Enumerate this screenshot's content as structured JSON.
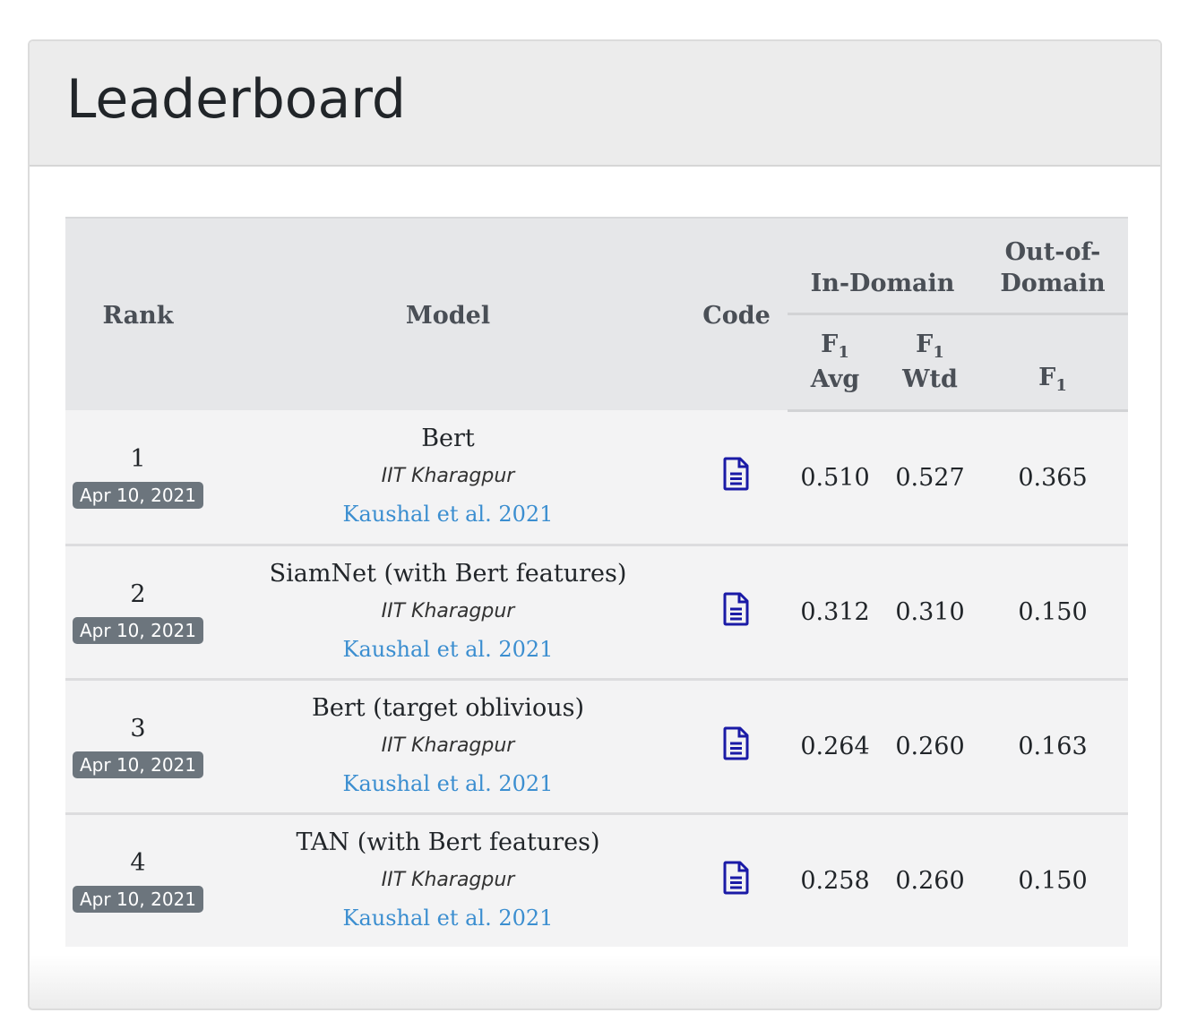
{
  "card": {
    "title": "Leaderboard"
  },
  "table": {
    "headers": {
      "rank": "Rank",
      "model": "Model",
      "code": "Code",
      "in_domain": "In-Domain",
      "out_of_domain_1": "Out-of-",
      "out_of_domain_2": "Domain",
      "f": "F",
      "f_sub": "1",
      "avg": "Avg",
      "wtd": "Wtd"
    },
    "rows": [
      {
        "rank": "1",
        "date": "Apr 10, 2021",
        "model": "Bert",
        "org": "IIT Kharagpur",
        "link": "Kaushal et al. 2021",
        "f1_avg": "0.510",
        "f1_wtd": "0.527",
        "ood_f1": "0.365"
      },
      {
        "rank": "2",
        "date": "Apr 10, 2021",
        "model": "SiamNet (with Bert features)",
        "org": "IIT Kharagpur",
        "link": "Kaushal et al. 2021",
        "f1_avg": "0.312",
        "f1_wtd": "0.310",
        "ood_f1": "0.150"
      },
      {
        "rank": "3",
        "date": "Apr 10, 2021",
        "model": "Bert (target oblivious)",
        "org": "IIT Kharagpur",
        "link": "Kaushal et al. 2021",
        "f1_avg": "0.264",
        "f1_wtd": "0.260",
        "ood_f1": "0.163"
      },
      {
        "rank": "4",
        "date": "Apr 10, 2021",
        "model": "TAN (with Bert features)",
        "org": "IIT Kharagpur",
        "link": "Kaushal et al. 2021",
        "f1_avg": "0.258",
        "f1_wtd": "0.260",
        "ood_f1": "0.150"
      }
    ],
    "code_icon": "document-icon",
    "colors": {
      "link": "#3b8ed0",
      "icon": "#1a1aa6",
      "badge": "#6c757d"
    }
  }
}
